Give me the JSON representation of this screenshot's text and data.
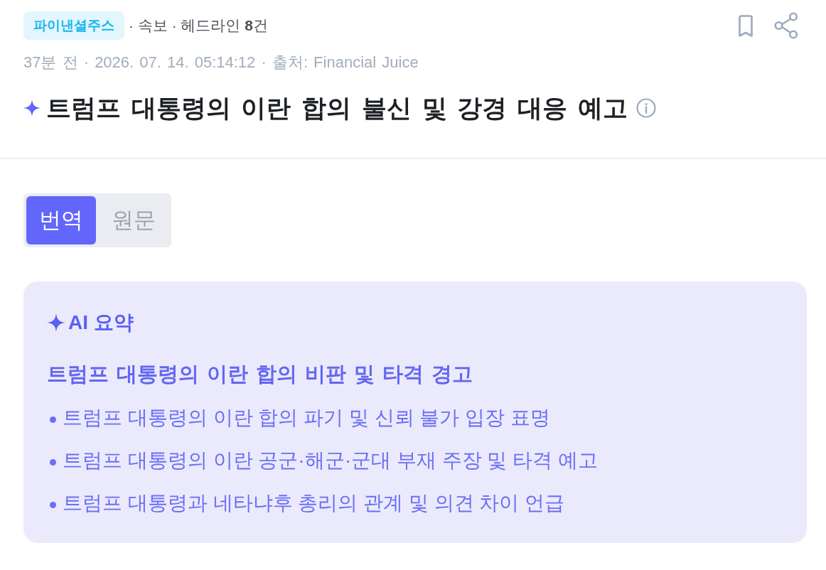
{
  "header": {
    "source_tag": "파이낸셜주스",
    "breadcrumb": "· 속보 · 헤드라인 **8**건",
    "meta": "37분 전 · 2026. 07. 14. 05:14:12 · 출처: Financial Juice",
    "title": "트럼프 대통령의 이란 합의 불신 및 강경 대응 예고"
  },
  "view_tabs": [
    {
      "label": "번역",
      "selected": true
    },
    {
      "label": "원문",
      "selected": false
    }
  ],
  "ai_summary": {
    "title": "AI 요약",
    "headline": "트럼프 대통령의 이란 합의 비판 및 타격 경고",
    "points": [
      "트럼프 대통령의 이란 합의 파기 및 신뢰 불가 입장 표명",
      "트럼프 대통령의 이란 공군·해군·군대 부재 주장 및 타격 예고",
      "트럼프 대통령과 네타냐후 총리의 관계 및 의견 차이 언급"
    ]
  }
}
